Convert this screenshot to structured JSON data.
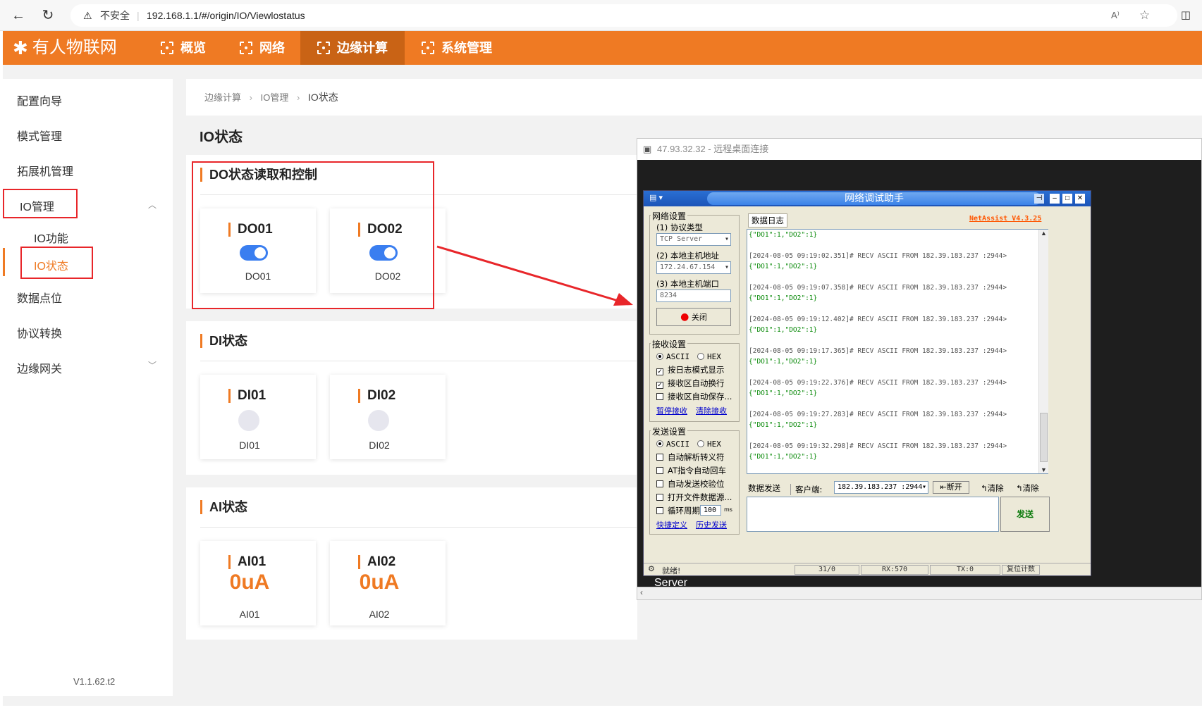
{
  "browser": {
    "security_label": "不安全",
    "url": "192.168.1.1/#/origin/IO/Viewlostatus"
  },
  "header": {
    "brand": "有人物联网",
    "nav": [
      {
        "label": "概览"
      },
      {
        "label": "网络"
      },
      {
        "label": "边缘计算",
        "active": true
      },
      {
        "label": "系统管理"
      }
    ],
    "accent_color": "#ef7a23"
  },
  "sidebar": {
    "items": [
      {
        "label": "配置向导"
      },
      {
        "label": "模式管理"
      },
      {
        "label": "拓展机管理"
      },
      {
        "label": "IO管理"
      },
      {
        "label": "数据点位"
      },
      {
        "label": "协议转换"
      },
      {
        "label": "边缘网关"
      }
    ],
    "io_sub": [
      {
        "label": "IO功能"
      },
      {
        "label": "IO状态",
        "active": true
      }
    ],
    "version": "V1.1.62.t2"
  },
  "breadcrumb": [
    "边缘计算",
    "IO管理",
    "IO状态"
  ],
  "page_title": "IO状态",
  "do_panel": {
    "title": "DO状态读取和控制",
    "cards": [
      {
        "title": "DO01",
        "label": "DO01",
        "on": true
      },
      {
        "title": "DO02",
        "label": "DO02",
        "on": true
      }
    ]
  },
  "di_panel": {
    "title": "DI状态",
    "cards": [
      {
        "title": "DI01",
        "label": "DI01"
      },
      {
        "title": "DI02",
        "label": "DI02"
      }
    ]
  },
  "ai_panel": {
    "title": "AI状态",
    "cards": [
      {
        "title": "AI01",
        "value": "0uA",
        "label": "AI01"
      },
      {
        "title": "AI02",
        "value": "0uA",
        "label": "AI02"
      }
    ]
  },
  "remote": {
    "title": "47.93.32.32 - 远程桌面连接",
    "server_label": "Server"
  },
  "netassist": {
    "title": "网络调试助手",
    "version": "NetAssist V4.3.25",
    "net_settings": {
      "group_title": "网络设置",
      "protocol_label": "(1) 协议类型",
      "protocol_value": "TCP Server",
      "host_label": "(2) 本地主机地址",
      "host_value": "172.24.67.154",
      "port_label": "(3) 本地主机端口",
      "port_value": "8234",
      "close_button": "关闭"
    },
    "recv_settings": {
      "group_title": "接收设置",
      "ascii": "ASCII",
      "hex": "HEX",
      "opt1": "按日志模式显示",
      "opt2": "接收区自动换行",
      "opt3": "接收区自动保存...",
      "link1": "暂停接收",
      "link2": "清除接收"
    },
    "send_settings": {
      "group_title": "发送设置",
      "ascii": "ASCII",
      "hex": "HEX",
      "opt1": "自动解析转义符",
      "opt2": "AT指令自动回车",
      "opt3": "自动发送校验位",
      "opt4": "打开文件数据源...",
      "opt5": "循环周期",
      "period_value": "100",
      "period_unit": "ms",
      "link1": "快捷定义",
      "link2": "历史发送"
    },
    "log_tab": "数据日志",
    "log": [
      {
        "head": "",
        "data": "{\"DO1\":1,\"DO2\":1}"
      },
      {
        "head": "[2024-08-05 09:19:02.351]# RECV ASCII FROM 182.39.183.237 :2944>",
        "data": "{\"DO1\":1,\"DO2\":1}"
      },
      {
        "head": "[2024-08-05 09:19:07.358]# RECV ASCII FROM 182.39.183.237 :2944>",
        "data": "{\"DO1\":1,\"DO2\":1}"
      },
      {
        "head": "[2024-08-05 09:19:12.402]# RECV ASCII FROM 182.39.183.237 :2944>",
        "data": "{\"DO1\":1,\"DO2\":1}"
      },
      {
        "head": "[2024-08-05 09:19:17.365]# RECV ASCII FROM 182.39.183.237 :2944>",
        "data": "{\"DO1\":1,\"DO2\":1}"
      },
      {
        "head": "[2024-08-05 09:19:22.376]# RECV ASCII FROM 182.39.183.237 :2944>",
        "data": "{\"DO1\":1,\"DO2\":1}"
      },
      {
        "head": "[2024-08-05 09:19:27.283]# RECV ASCII FROM 182.39.183.237 :2944>",
        "data": "{\"DO1\":1,\"DO2\":1}"
      },
      {
        "head": "[2024-08-05 09:19:32.298]# RECV ASCII FROM 182.39.183.237 :2944>",
        "data": "{\"DO1\":1,\"DO2\":1}"
      }
    ],
    "send_bar": {
      "send_label": "数据发送",
      "client_label": "客户端:",
      "client_value": "182.39.183.237 :2944",
      "disconnect": "断开",
      "clear1": "清除",
      "clear2": "清除",
      "send_button": "发送"
    },
    "status": {
      "ready": "就绪!",
      "count": "31/0",
      "rx": "RX:570",
      "tx": "TX:0",
      "reset": "复位计数"
    }
  }
}
